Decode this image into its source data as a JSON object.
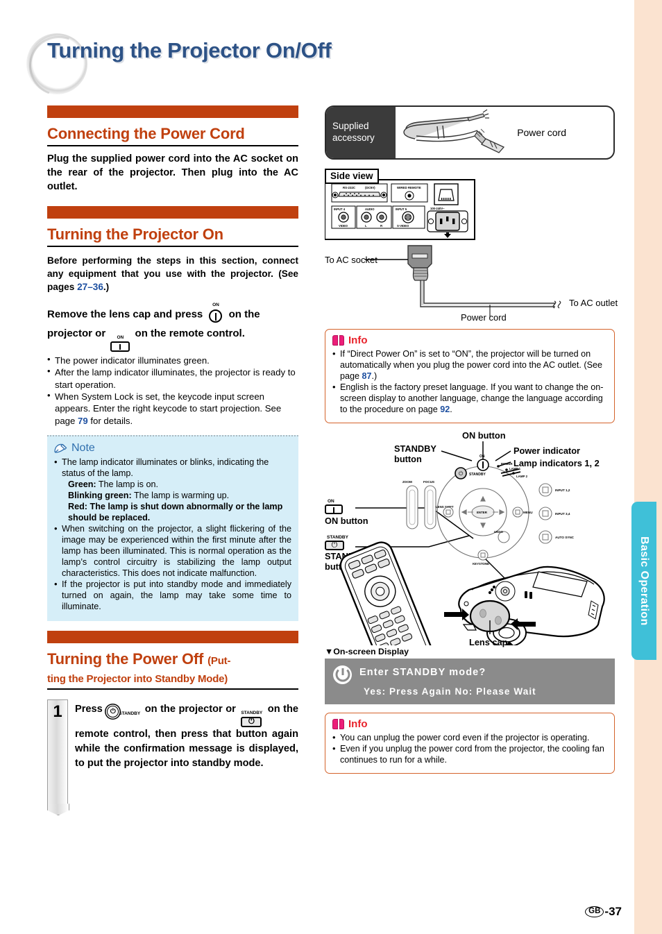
{
  "page": {
    "title": "Turning the Projector On/Off",
    "number_label": "-37",
    "region_code": "GB",
    "side_tab": "Basic Operation",
    "accent_orange": "#c0400f",
    "accent_blue": "#1d4fa0",
    "title_color": "#2d5286",
    "note_bg": "#d6eef8",
    "info_red": "#e8212a",
    "tab_cyan": "#3fc0d8"
  },
  "left": {
    "section1": {
      "heading": "Connecting the Power Cord",
      "lead": "Plug the supplied power cord into the AC socket on the rear of the projector. Then plug into the AC outlet."
    },
    "section2": {
      "heading": "Turning the Projector On",
      "intro_a": "Before performing the steps in this section, connect any equipment that you use with the projector. (See pages ",
      "intro_pages": "27–36",
      "intro_b": ".)",
      "instruction_a": "Remove the lens cap and press",
      "instruction_b": "on the projector or",
      "instruction_c": "on the remote control.",
      "on_glyph_label": "ON",
      "bullets": [
        "The power indicator illuminates green.",
        "After the lamp indicator illuminates, the projector is ready to start operation.",
        "When System Lock is set, the keycode input screen appears. Enter the right keycode to start projection. See page 79 for details."
      ],
      "bullet3_a": "When System Lock is set, the keycode input screen appears. Enter the right keycode to start projection. See page ",
      "bullet3_page": "79",
      "bullet3_b": " for details."
    },
    "note": {
      "title": "Note",
      "icon": "pencil-icon",
      "bullet1": "The lamp indicator illuminates or blinks, indicating the status of the lamp.",
      "sub_green_label": "Green:",
      "sub_green_text": " The lamp is on.",
      "sub_blink_label": "Blinking green:",
      "sub_blink_text": " The lamp is warming up.",
      "sub_red_label": "Red:",
      "sub_red_text": " The lamp is shut down abnormally or the lamp should be replaced.",
      "bullet2": "When switching on the projector, a slight flickering of the image may be experienced within the first minute after the lamp has been illuminated. This is normal operation as the lamp’s control circuitry is stabilizing the lamp output characteristics. This does not indicate malfunction.",
      "bullet3": "If the projector is put into standby mode and immediately turned on again, the lamp may take some time to illuminate."
    },
    "section3": {
      "heading_main": "Turning the Power Off",
      "heading_sub_line1": "(Put-",
      "heading_sub_line2": "ting the Projector into Standby Mode)",
      "step_number": "1",
      "step_text_a": "Press",
      "step_text_b": "on the projector or",
      "step_text_c": "on the remote control, then press that button again while the confirmation message is displayed, to put the projector into standby mode.",
      "standby_glyph_label": "STANDBY"
    }
  },
  "right": {
    "supplied": {
      "tag_line1": "Supplied",
      "tag_line2": "accessory",
      "item_label": "Power cord"
    },
    "sideview": {
      "tag": "Side view",
      "ports": [
        "RS-232C",
        "WIRED REMOTE",
        "INPUT 4",
        "AUDIO",
        "INPUT 5",
        "VIDEO",
        "L",
        "R",
        "S-VIDEO",
        "100-240V~"
      ]
    },
    "cord": {
      "to_ac_socket": "To AC socket",
      "to_ac_outlet": "To AC outlet",
      "power_cord": "Power cord"
    },
    "info1": {
      "title": "Info",
      "icon": "book-icon",
      "bullet1_a": "If “Direct Power On” is set to “ON”, the projector will be turned on automatically when you plug the power cord into the AC outlet. (See page ",
      "bullet1_page": "87",
      "bullet1_b": ".)",
      "bullet2_a": "English is the factory preset language. If you want to change the on-screen display to another language, change the language according to the procedure on page ",
      "bullet2_page": "92",
      "bullet2_b": "."
    },
    "illustration": {
      "on_button_top": "ON button",
      "standby_button_line1": "STANDBY",
      "standby_button_line2": "button",
      "power_indicator": "Power indicator",
      "lamp_indicators": "Lamp indicators 1, 2",
      "remote_on_label": "ON",
      "remote_on_button": "ON button",
      "remote_standby_label": "STANDBY",
      "remote_standby_line1": "STANDBY",
      "remote_standby_line2": "button",
      "lens_cap": "Lens cap",
      "panel_labels": [
        "ZOOM",
        "FOCUS",
        "LENS SHIFT",
        "ENTER",
        "UNDO",
        "MENU",
        "KEYSTONE",
        "INPUT 1,2",
        "INPUT 3,4",
        "AUTO SYNC",
        "ON",
        "STANDBY"
      ]
    },
    "osd": {
      "heading": "▼On-screen Display",
      "line1": "Enter STANDBY mode?",
      "line2": "Yes: Press Again  No: Please Wait",
      "icon": "power-icon"
    },
    "info2": {
      "title": "Info",
      "icon": "book-icon",
      "bullet1": "You can unplug the power cord even if the projector is operating.",
      "bullet2": "Even if you unplug the power cord from the projector, the cooling fan continues to run for a while."
    }
  }
}
